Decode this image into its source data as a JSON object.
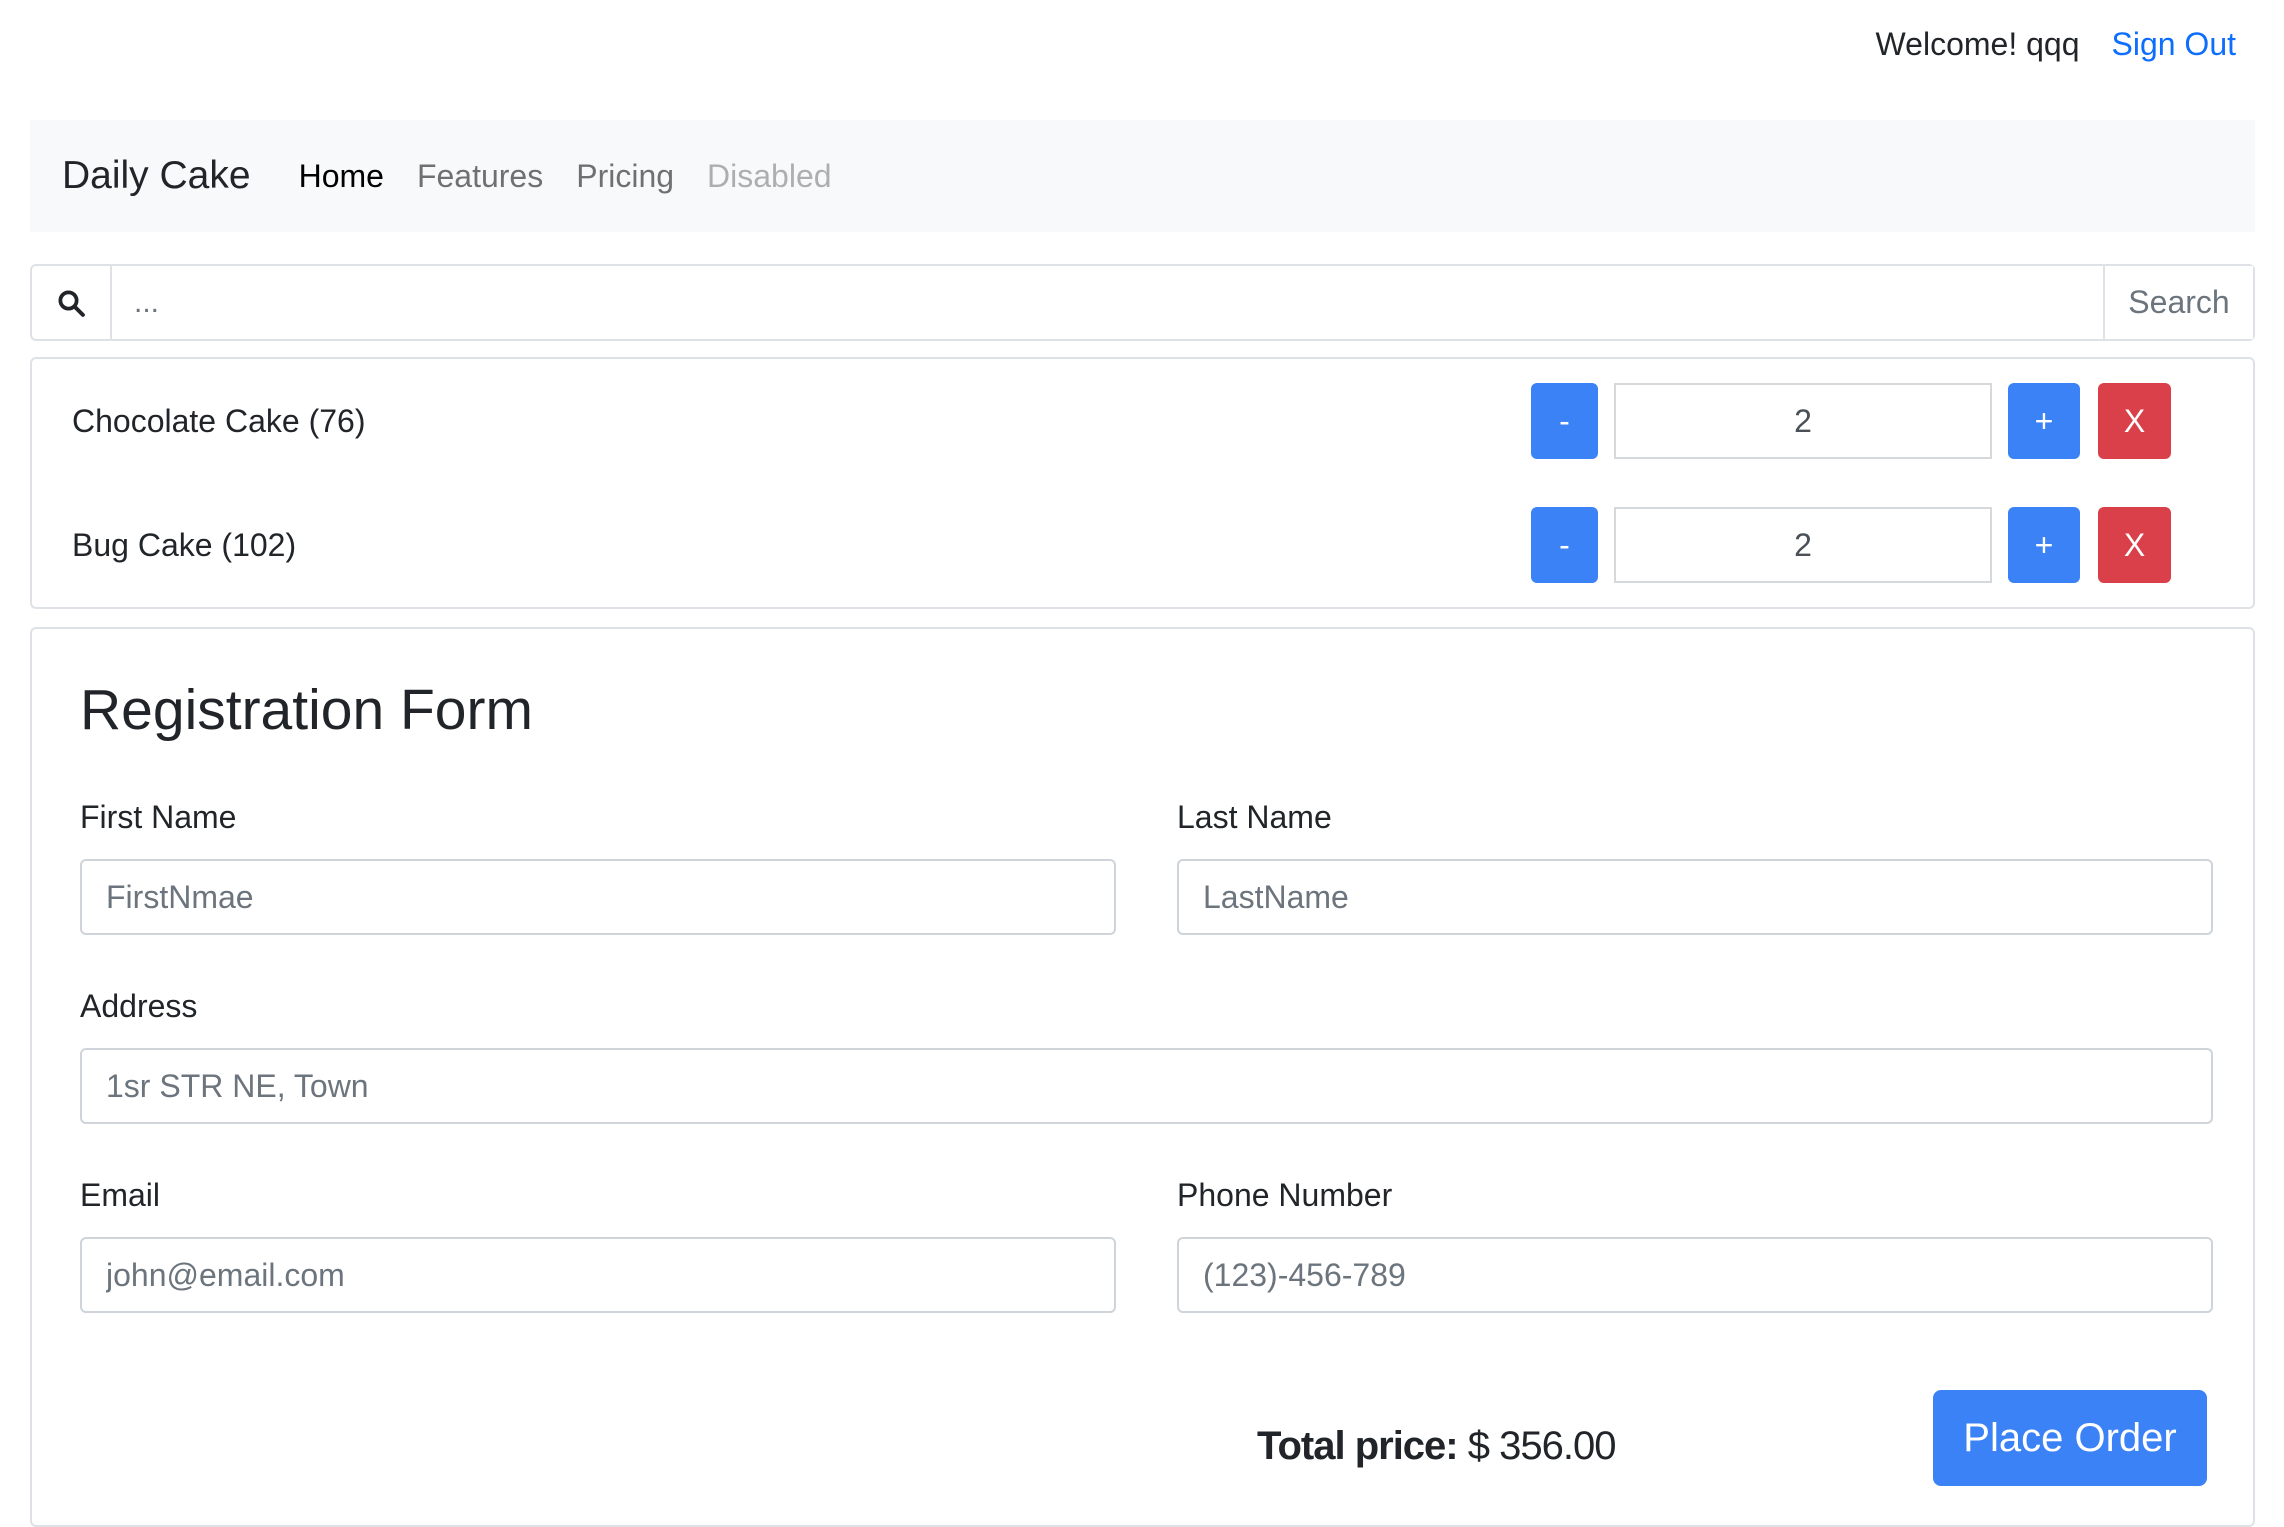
{
  "user": {
    "welcome": "Welcome! qqq",
    "sign_out": "Sign Out"
  },
  "navbar": {
    "brand": "Daily Cake",
    "links": [
      {
        "label": "Home",
        "state": "active"
      },
      {
        "label": "Features",
        "state": "normal"
      },
      {
        "label": "Pricing",
        "state": "normal"
      },
      {
        "label": "Disabled",
        "state": "disabled"
      }
    ]
  },
  "search": {
    "icon": "search-icon",
    "placeholder": "...",
    "button": "Search"
  },
  "cart": {
    "items": [
      {
        "name": "Chocolate Cake (76)",
        "quantity": "2",
        "minus": "-",
        "plus": "+",
        "remove": "X"
      },
      {
        "name": "Bug Cake (102)",
        "quantity": "2",
        "minus": "-",
        "plus": "+",
        "remove": "X"
      }
    ]
  },
  "form": {
    "title": "Registration Form",
    "first_name": {
      "label": "First Name",
      "placeholder": "FirstNmae"
    },
    "last_name": {
      "label": "Last Name",
      "placeholder": "LastName"
    },
    "address": {
      "label": "Address",
      "placeholder": "1sr STR NE, Town"
    },
    "email": {
      "label": "Email",
      "placeholder": "john@email.com"
    },
    "phone": {
      "label": "Phone Number",
      "placeholder": "(123)-456-789"
    },
    "total_label": "Total price:",
    "total_amount": "$ 356.00",
    "submit": "Place Order"
  },
  "colors": {
    "primary": "#3b82f6",
    "danger": "#d9404a",
    "link": "#0d6efd",
    "navbar_bg": "#f8f9fa"
  }
}
